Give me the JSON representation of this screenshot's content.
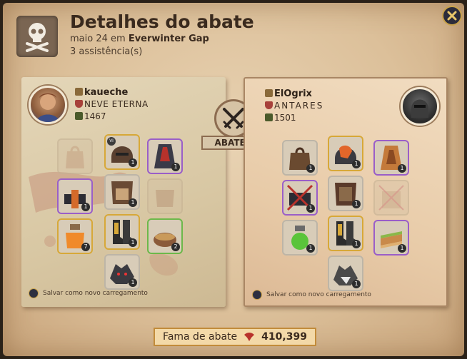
{
  "header": {
    "title": "Detalhes do abate",
    "date": "maio 24 em",
    "location": "Everwinter Gap",
    "assists": "3 assistência(s)"
  },
  "center": {
    "label": "ABATEU"
  },
  "killer": {
    "name": "kaueche",
    "guild": "NEVE ETERNA",
    "ip": "1467",
    "save_label": "Salvar como novo carregamento"
  },
  "victim": {
    "name": "ElOgrix",
    "guild": "ANTARES",
    "ip": "1501",
    "save_label": "Salvar como novo carregamento"
  },
  "footer": {
    "fame_label": "Fama de abate",
    "fame_value": "410,399"
  },
  "colors": {
    "accent": "#c9a24a",
    "parchment": "#dcc09a",
    "quality_yellow": "#d7a838",
    "quality_purple": "#9a5ec8",
    "quality_green": "#6cb84a"
  }
}
